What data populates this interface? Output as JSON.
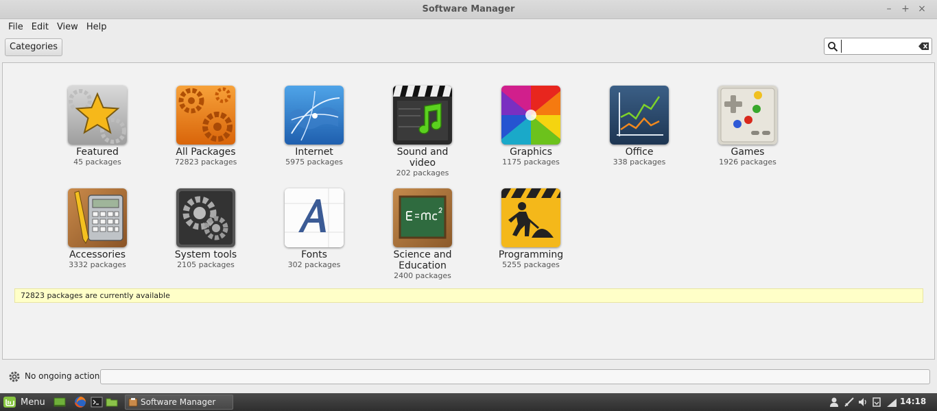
{
  "window": {
    "title": "Software Manager",
    "controls": [
      "–",
      "+",
      "×"
    ]
  },
  "menubar": [
    "File",
    "Edit",
    "View",
    "Help"
  ],
  "toolbar": {
    "categories_label": "Categories",
    "search": {
      "value": "",
      "placeholder": ""
    }
  },
  "categories": [
    {
      "name": "Featured",
      "count": "45 packages",
      "icon": "featured-star-icon"
    },
    {
      "name": "All Packages",
      "count": "72823 packages",
      "icon": "gears-icon"
    },
    {
      "name": "Internet",
      "count": "5975 packages",
      "icon": "globe-icon"
    },
    {
      "name": "Sound and\nvideo",
      "count": "202 packages",
      "icon": "clapper-music-icon"
    },
    {
      "name": "Graphics",
      "count": "1175 packages",
      "icon": "color-wheel-icon"
    },
    {
      "name": "Office",
      "count": "338 packages",
      "icon": "line-chart-icon"
    },
    {
      "name": "Games",
      "count": "1926 packages",
      "icon": "gamepad-icon"
    },
    {
      "name": "Accessories",
      "count": "3332 packages",
      "icon": "calculator-icon"
    },
    {
      "name": "System tools",
      "count": "2105 packages",
      "icon": "system-gears-icon"
    },
    {
      "name": "Fonts",
      "count": "302 packages",
      "icon": "font-icon"
    },
    {
      "name": "Science and\nEducation",
      "count": "2400 packages",
      "icon": "chalkboard-icon"
    },
    {
      "name": "Programming",
      "count": "5255 packages",
      "icon": "construction-icon"
    }
  ],
  "notice": "72823 packages are currently available",
  "statusbar": {
    "text": "No ongoing actions"
  },
  "taskbar": {
    "menu_label": "Menu",
    "task_label": "Software Manager",
    "clock": "14:18"
  }
}
